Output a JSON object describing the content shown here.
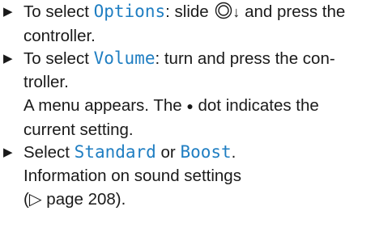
{
  "steps": [
    {
      "marker": "▶",
      "prefix": "To select ",
      "keyword": "Options",
      "mid": ": slide ",
      "arrow": "↓",
      "suffix": " and press the controller."
    },
    {
      "marker": "▶",
      "prefix": "To select ",
      "keyword": "Volume",
      "suffix": ": turn and press the con-troller.",
      "note_prefix": "A menu appears. The ",
      "dot": "●",
      "note_suffix": " dot indicates the current setting."
    },
    {
      "marker": "▶",
      "prefix": "Select ",
      "keyword1": "Standard",
      "joiner": " or ",
      "keyword2": "Boost",
      "end": ".",
      "info": "Information on sound settings",
      "ref": "(▷ page 208)."
    }
  ]
}
